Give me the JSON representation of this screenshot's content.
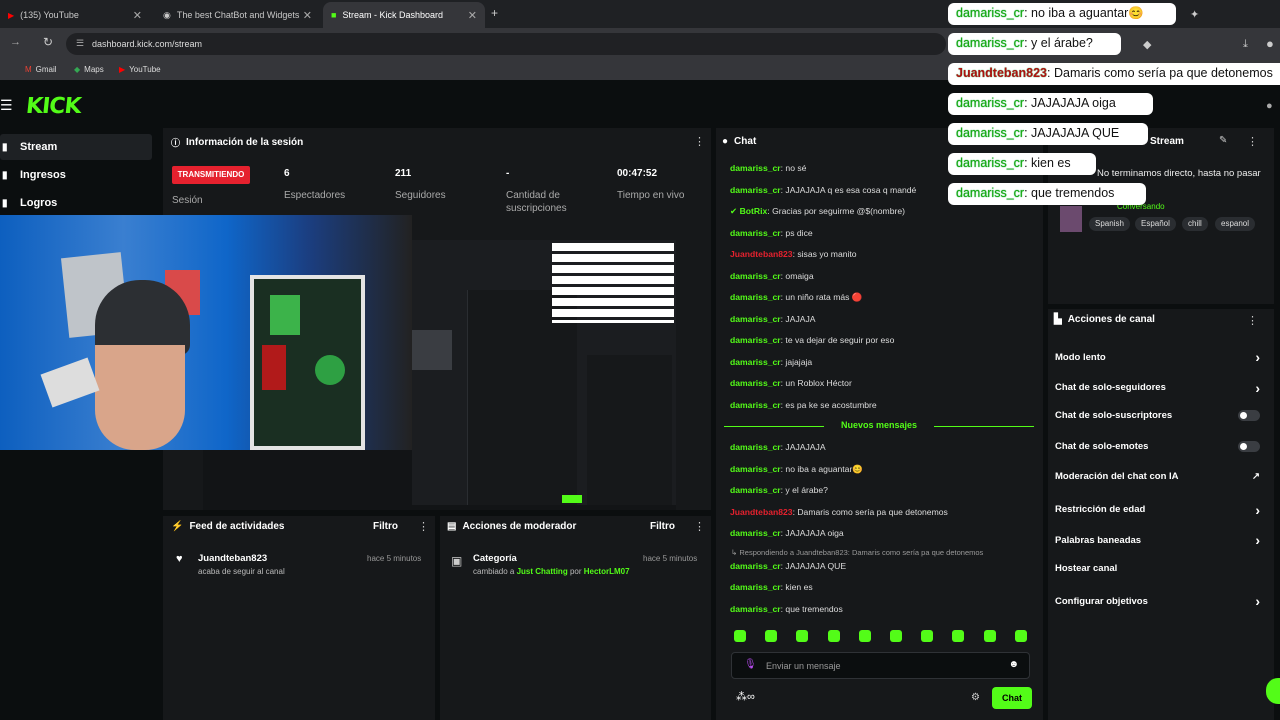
{
  "browser": {
    "tabs": [
      {
        "label": "(135) YouTube"
      },
      {
        "label": "The best ChatBot and Widgets"
      },
      {
        "label": "Stream - Kick Dashboard"
      }
    ],
    "url": "dashboard.kick.com/stream",
    "bookmarks": [
      "Gmail",
      "Maps",
      "YouTube"
    ]
  },
  "kick": {
    "logo": "KICK",
    "sidebar": [
      {
        "label": "Stream"
      },
      {
        "label": "Ingresos"
      },
      {
        "label": "Logros"
      }
    ],
    "session": {
      "title": "Información de la sesión",
      "status_badge": "TRANSMITIENDO",
      "status_label": "Sesión",
      "stats": [
        {
          "value": "6",
          "label": "Espectadores"
        },
        {
          "value": "211",
          "label": "Seguidores"
        },
        {
          "value": "-",
          "label": "Cantidad de suscripciones"
        },
        {
          "value": "00:47:52",
          "label": "Tiempo en vivo"
        }
      ]
    },
    "activity_feed": {
      "title": "Feed de actividades",
      "filter": "Filtro",
      "items": [
        {
          "user": "Juandteban823",
          "text": "acaba de seguir al canal",
          "time": "hace 5 minutos"
        }
      ]
    },
    "mod_actions": {
      "title": "Acciones de moderador",
      "filter": "Filtro",
      "items": [
        {
          "title": "Categoría",
          "text_pre": "cambiado a",
          "category": "Just Chatting",
          "by": "por",
          "mod": "HectorLM07",
          "time": "hace 5 minutos"
        }
      ]
    },
    "chat": {
      "title": "Chat",
      "messages": [
        {
          "user": "damariss_cr",
          "text": ": no sé"
        },
        {
          "user": "damariss_cr",
          "text": ": JAJAJAJA q es esa cosa q mandé"
        },
        {
          "user": "BotRix",
          "text": ": Gracias por seguirme @$(nombre)"
        },
        {
          "user": "damariss_cr",
          "text": ": ps dice"
        },
        {
          "user": "Juandteban823",
          "text": ": sisas yo manito"
        },
        {
          "user": "damariss_cr",
          "text": ": omaiga"
        },
        {
          "user": "damariss_cr",
          "text": ": un niño rata más 🔴"
        },
        {
          "user": "damariss_cr",
          "text": ": JAJAJA"
        },
        {
          "user": "damariss_cr",
          "text": ": te va dejar de seguir por eso"
        },
        {
          "user": "damariss_cr",
          "text": ": jajajaja"
        },
        {
          "user": "damariss_cr",
          "text": ": un Roblox Héctor"
        },
        {
          "user": "damariss_cr",
          "text": ": es pa ke se acostumbre"
        }
      ],
      "new_messages_label": "Nuevos mensajes",
      "new_messages": [
        {
          "user": "damariss_cr",
          "text": ": JAJAJAJA"
        },
        {
          "user": "damariss_cr",
          "text": ": no iba a aguantar😊"
        },
        {
          "user": "damariss_cr",
          "text": ": y el árabe?"
        },
        {
          "user": "Juandteban823",
          "text": ": Damaris como sería pa que detonemos"
        },
        {
          "user": "damariss_cr",
          "text": ": JAJAJAJA oiga"
        },
        {
          "user": "damariss_cr",
          "text": ": JAJAJAJA QUE"
        },
        {
          "user": "damariss_cr",
          "text": ": kien es"
        },
        {
          "user": "damariss_cr",
          "text": ": que tremendos"
        }
      ],
      "reply_note": "Respondiendo a Juandteban823: Damaris como sería pa que detonemos",
      "input_placeholder": "Enviar un mensaje",
      "send_label": "Chat"
    },
    "stream_info": {
      "title": "Stream",
      "subtitle": "No terminamos directo, hasta no pasar",
      "category": "Conversando",
      "tags": [
        "Spanish",
        "Español",
        "chill",
        "espanol"
      ]
    },
    "channel_actions": {
      "title": "Acciones de canal",
      "items": [
        {
          "label": "Modo lento",
          "control": "chevron"
        },
        {
          "label": "Chat de solo-seguidores",
          "control": "chevron"
        },
        {
          "label": "Chat de solo-suscriptores",
          "control": "toggle"
        },
        {
          "label": "Chat de solo-emotes",
          "control": "toggle"
        },
        {
          "label": "Moderación del chat con IA",
          "control": "external"
        },
        {
          "label": "Restricción de edad",
          "control": "chevron"
        },
        {
          "label": "Palabras baneadas",
          "control": "chevron"
        },
        {
          "label": "Hostear canal",
          "control": "none"
        },
        {
          "label": "Configurar objetivos",
          "control": "chevron"
        }
      ]
    }
  },
  "overlay": {
    "messages": [
      {
        "user": "damariss_cr",
        "text": ": no iba a aguantar😊"
      },
      {
        "user": "damariss_cr",
        "text": ": y el árabe?"
      },
      {
        "user": "Juandteban823",
        "text": ": Damaris como sería pa que detonemos"
      },
      {
        "user": "damariss_cr",
        "text": ": JAJAJAJA oiga"
      },
      {
        "user": "damariss_cr",
        "text": ": JAJAJAJA QUE"
      },
      {
        "user": "damariss_cr",
        "text": ": kien es"
      },
      {
        "user": "damariss_cr",
        "text": ": que tremendos"
      }
    ]
  },
  "colors": {
    "kick_green": "#53fc18",
    "live_red": "#e5212e",
    "panel": "#16181a"
  }
}
